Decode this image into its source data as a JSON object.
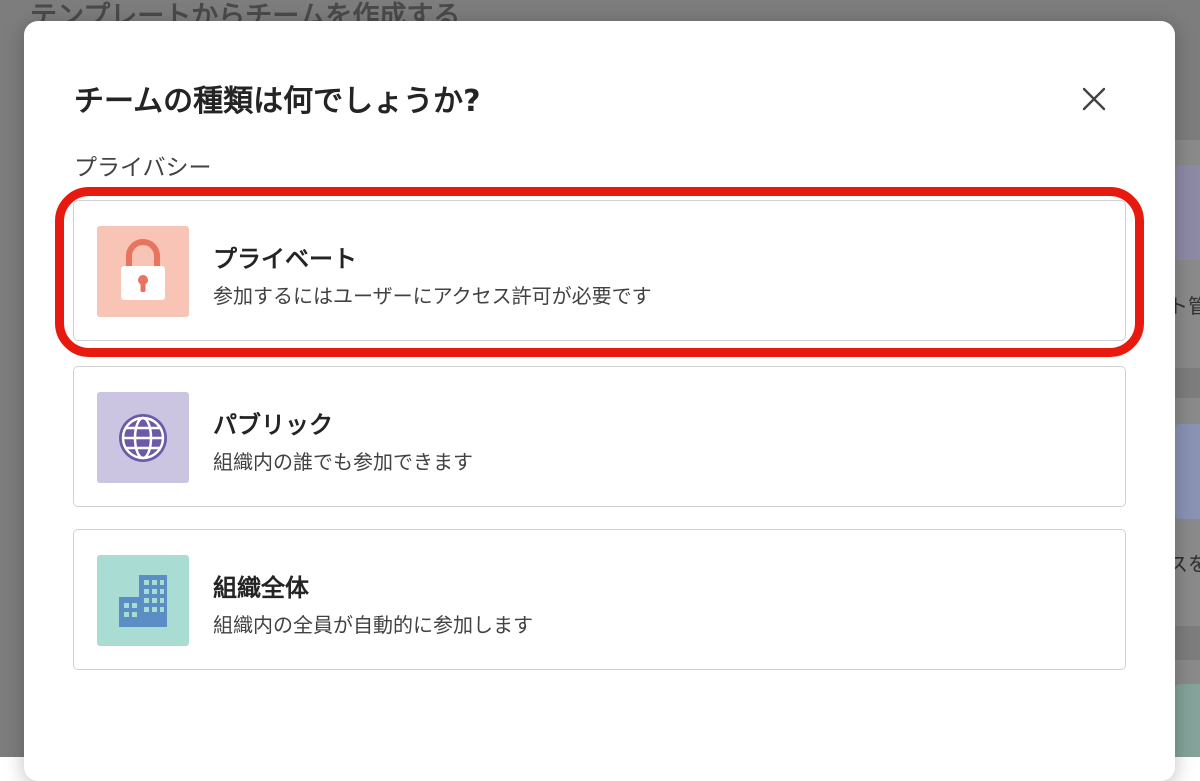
{
  "background": {
    "page_title": "テンプレートからチームを作成する",
    "side_text_1": "ト管",
    "side_text_2": "スを"
  },
  "dialog": {
    "title": "チームの種類は何でしょうか?",
    "close_icon": "close-icon",
    "section_label": "プライバシー"
  },
  "options": [
    {
      "title": "プライベート",
      "description": "参加するにはユーザーにアクセス許可が必要です",
      "icon": "lock-icon",
      "tile_color": "#f7c4b6",
      "icon_color": "#e8735e"
    },
    {
      "title": "パブリック",
      "description": "組織内の誰でも参加できます",
      "icon": "globe-icon",
      "tile_color": "#cbc5e2",
      "icon_color": "#6c5aa8"
    },
    {
      "title": "組織全体",
      "description": "組織内の全員が自動的に参加します",
      "icon": "building-icon",
      "tile_color": "#a9ddd4",
      "icon_color": "#5a8ec4"
    }
  ],
  "highlight_color": "#e81a10"
}
